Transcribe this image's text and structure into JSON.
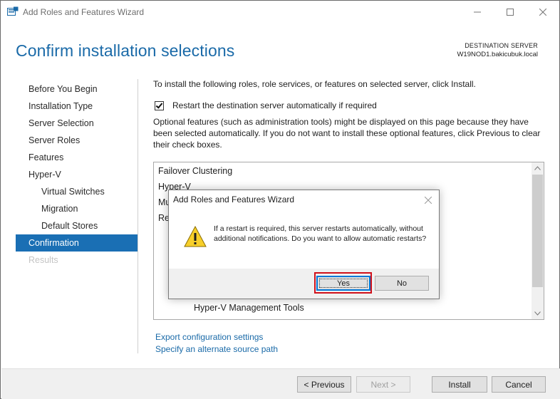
{
  "window": {
    "title": "Add Roles and Features Wizard"
  },
  "header": {
    "page_title": "Confirm installation selections",
    "destination_label": "DESTINATION SERVER",
    "destination_server": "W19NOD1.bakicubuk.local"
  },
  "nav": {
    "items": [
      {
        "label": "Before You Begin"
      },
      {
        "label": "Installation Type"
      },
      {
        "label": "Server Selection"
      },
      {
        "label": "Server Roles"
      },
      {
        "label": "Features"
      },
      {
        "label": "Hyper-V"
      },
      {
        "label": "Virtual Switches"
      },
      {
        "label": "Migration"
      },
      {
        "label": "Default Stores"
      },
      {
        "label": "Confirmation"
      },
      {
        "label": "Results"
      }
    ]
  },
  "content": {
    "intro": "To install the following roles, role services, or features on selected server, click Install.",
    "restart_label": "Restart the destination server automatically if required",
    "restart_checked": true,
    "optional_text": "Optional features (such as administration tools) might be displayed on this page because they have been selected automatically. If you do not want to install these optional features, click Previous to clear their check boxes.",
    "list": {
      "items": [
        {
          "label": "Failover Clustering"
        },
        {
          "label": "Hyper-V"
        },
        {
          "label": "Mu"
        },
        {
          "label": "Re"
        },
        {
          "label": "Hyper-V Management Tools"
        }
      ]
    },
    "links": {
      "export": "Export configuration settings",
      "alternate_source": "Specify an alternate source path"
    }
  },
  "footer": {
    "previous": "< Previous",
    "next": "Next >",
    "install": "Install",
    "cancel": "Cancel"
  },
  "dialog": {
    "title": "Add Roles and Features Wizard",
    "message": "If a restart is required, this server restarts automatically, without additional notifications. Do you want to allow automatic restarts?",
    "yes": "Yes",
    "no": "No"
  },
  "colors": {
    "accent": "#1a6fb4",
    "title_blue": "#1a6aa8",
    "highlight": "#d0111b"
  }
}
